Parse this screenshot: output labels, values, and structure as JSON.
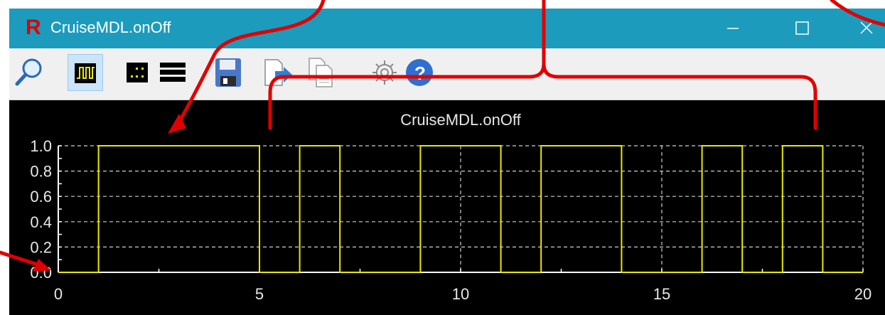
{
  "window": {
    "title": "CruiseMDL.onOff",
    "logo_letter": "R",
    "title_bar_color": "#1c9bbd",
    "minimize_icon": "minimize-icon",
    "maximize_icon": "maximize-icon",
    "close_icon": "close-icon"
  },
  "toolbar": {
    "buttons": [
      {
        "name": "zoom-button",
        "icon": "magnifier-icon",
        "active": false
      },
      {
        "name": "step-plot-button",
        "icon": "step-wave-icon",
        "active": true
      },
      {
        "name": "points-plot-button",
        "icon": "dots-icon",
        "active": false
      },
      {
        "name": "bars-plot-button",
        "icon": "horizontal-bars-icon",
        "active": false
      },
      {
        "name": "save-button",
        "icon": "floppy-disk-icon",
        "active": false
      },
      {
        "name": "export-button",
        "icon": "export-arrow-icon",
        "active": false
      },
      {
        "name": "copy-button",
        "icon": "copy-pages-icon",
        "active": false
      },
      {
        "name": "settings-button",
        "icon": "gear-icon",
        "active": false
      },
      {
        "name": "help-button",
        "icon": "help-icon",
        "active": false
      }
    ]
  },
  "chart_data": {
    "type": "line",
    "step": true,
    "title": "CruiseMDL.onOff",
    "xlabel": "",
    "ylabel": "",
    "xlim": [
      0,
      20
    ],
    "ylim": [
      0,
      1
    ],
    "x_ticks": [
      "0",
      "5",
      "10",
      "15",
      "20"
    ],
    "y_ticks": [
      "0.0",
      "0.2",
      "0.4",
      "0.6",
      "0.8",
      "1.0"
    ],
    "grid": true,
    "series": [
      {
        "color": "#e8e800",
        "x": [
          0,
          1,
          1,
          5,
          5,
          6,
          6,
          7,
          7,
          9,
          9,
          11,
          11,
          12,
          12,
          14,
          14,
          16,
          16,
          17,
          17,
          18,
          18,
          19,
          19,
          20
        ],
        "y": [
          0,
          0,
          1,
          1,
          0,
          0,
          1,
          1,
          0,
          0,
          1,
          1,
          0,
          0,
          1,
          1,
          0,
          0,
          1,
          1,
          0,
          0,
          1,
          1,
          0,
          0
        ]
      }
    ]
  },
  "colors": {
    "plot_background": "#000000",
    "axis": "#ffffff",
    "grid": "#cfcfcf",
    "annotation": "#e00000"
  }
}
